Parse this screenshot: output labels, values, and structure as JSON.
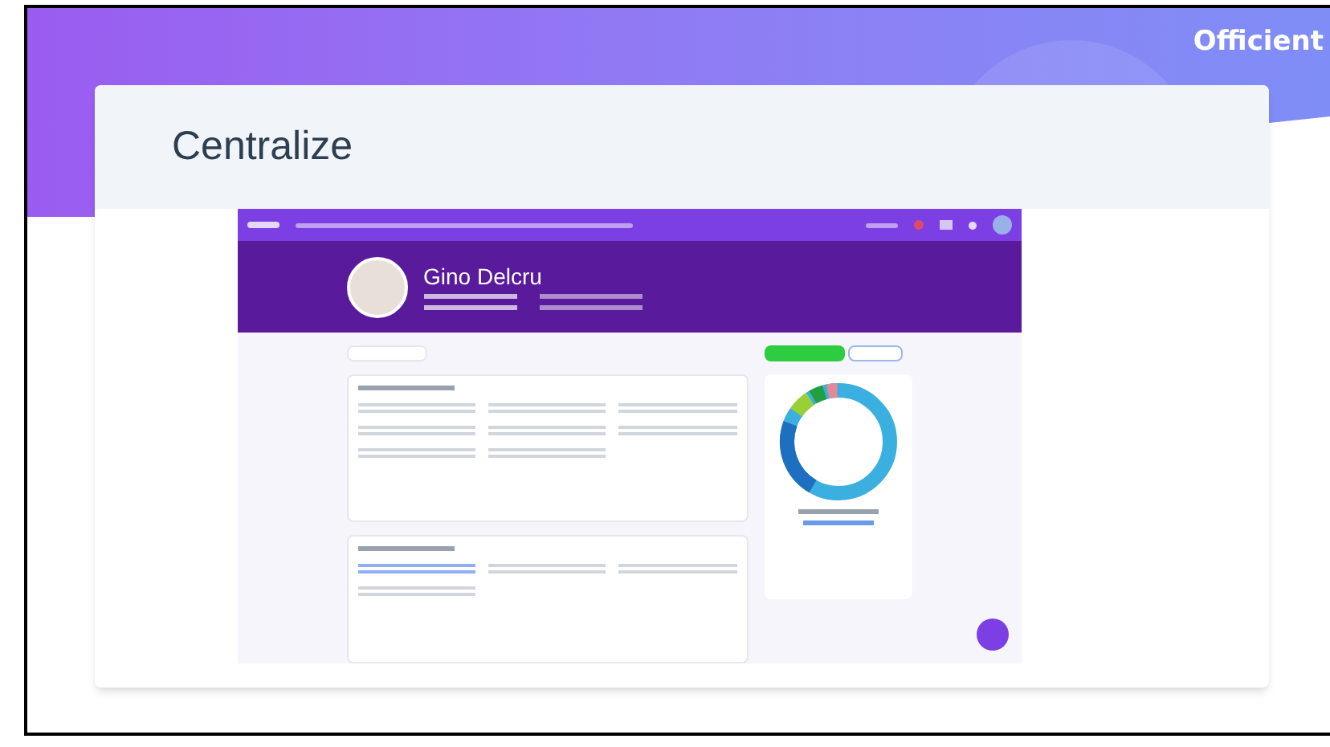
{
  "brand": {
    "name": "Officient"
  },
  "slide": {
    "title": "Centralize"
  },
  "screenshot": {
    "profile_name": "Gino Delcru"
  }
}
